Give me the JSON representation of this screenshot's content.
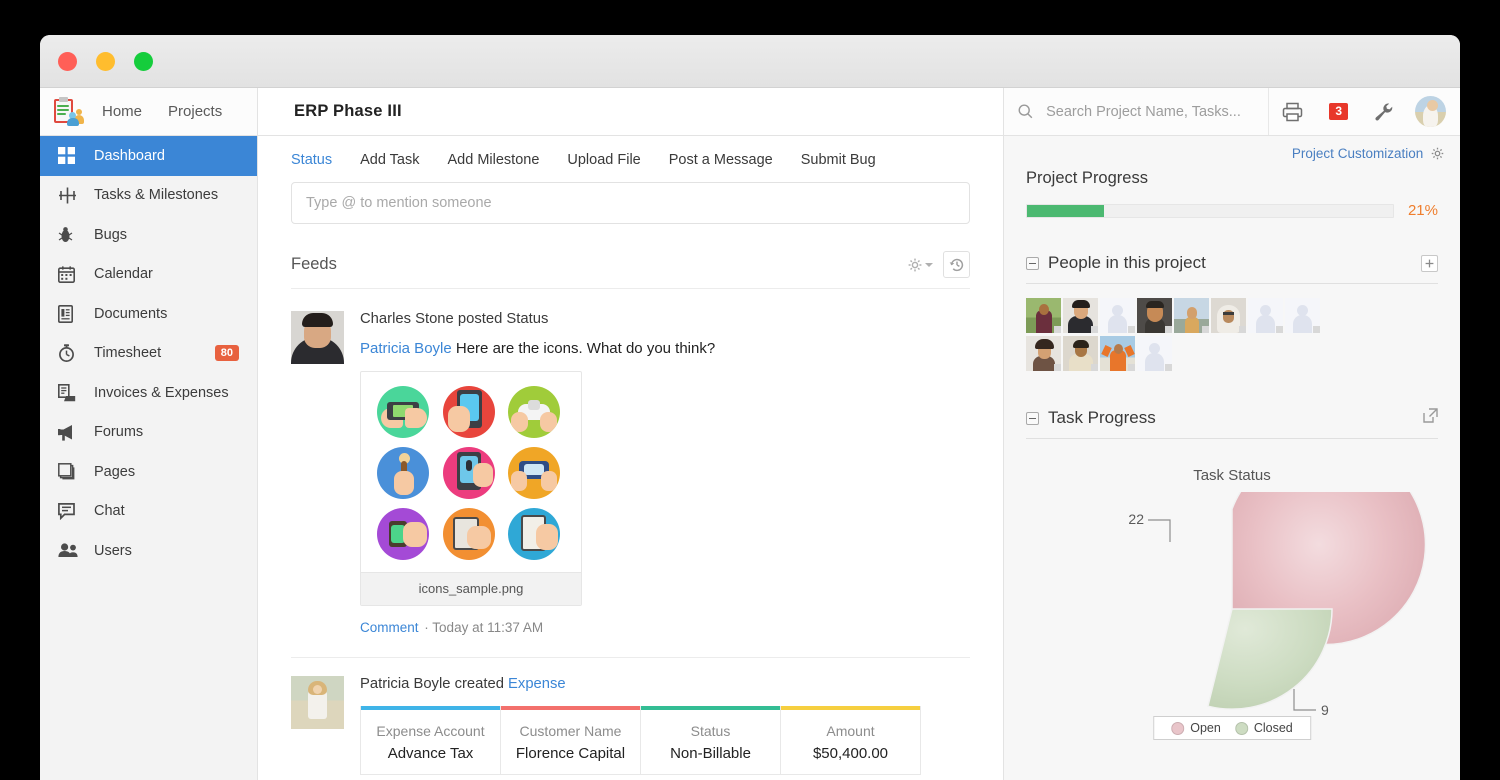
{
  "window": {
    "controls": [
      "close",
      "minimize",
      "maximize"
    ]
  },
  "topbar": {
    "logo_name": "zoho-projects-logo",
    "nav": [
      {
        "label": "Home",
        "name": "nav-home"
      },
      {
        "label": "Projects",
        "name": "nav-projects"
      }
    ],
    "project_title": "ERP Phase III",
    "search": {
      "placeholder": "Search Project Name, Tasks...",
      "value": ""
    },
    "print_icon": "printer-icon",
    "notification_count": "3",
    "settings_icon": "wrench-icon",
    "avatar": "user-avatar"
  },
  "sidebar": {
    "items": [
      {
        "label": "Dashboard",
        "icon": "grid-icon",
        "active": true,
        "badge": ""
      },
      {
        "label": "Tasks & Milestones",
        "icon": "milestone-icon",
        "active": false,
        "badge": ""
      },
      {
        "label": "Bugs",
        "icon": "bug-icon",
        "active": false,
        "badge": ""
      },
      {
        "label": "Calendar",
        "icon": "calendar-icon",
        "active": false,
        "badge": ""
      },
      {
        "label": "Documents",
        "icon": "document-icon",
        "active": false,
        "badge": ""
      },
      {
        "label": "Timesheet",
        "icon": "stopwatch-icon",
        "active": false,
        "badge": "80"
      },
      {
        "label": "Invoices & Expenses",
        "icon": "invoice-icon",
        "active": false,
        "badge": ""
      },
      {
        "label": "Forums",
        "icon": "megaphone-icon",
        "active": false,
        "badge": ""
      },
      {
        "label": "Pages",
        "icon": "pages-icon",
        "active": false,
        "badge": ""
      },
      {
        "label": "Chat",
        "icon": "chat-icon",
        "active": false,
        "badge": ""
      },
      {
        "label": "Users",
        "icon": "users-icon",
        "active": false,
        "badge": ""
      }
    ]
  },
  "main": {
    "tabs": [
      {
        "label": "Status",
        "active": true
      },
      {
        "label": "Add Task",
        "active": false
      },
      {
        "label": "Add Milestone",
        "active": false
      },
      {
        "label": "Upload File",
        "active": false
      },
      {
        "label": "Post a Message",
        "active": false
      },
      {
        "label": "Submit Bug",
        "active": false
      }
    ],
    "status_input": {
      "placeholder": "Type @ to mention someone",
      "value": ""
    },
    "feeds_title": "Feeds",
    "feeds_gear_icon": "gear-dropdown-icon",
    "feeds_history_icon": "history-icon",
    "feeds": [
      {
        "author_line": "Charles Stone posted Status",
        "mention": "Patricia Boyle",
        "text": " Here are the icons. What do you think?",
        "attachment": {
          "filename": "icons_sample.png"
        },
        "comment_label": "Comment",
        "separator": "·",
        "timestamp": "Today at 11:37 AM"
      },
      {
        "author_line_prefix": "Patricia Boyle created ",
        "author_line_link": "Expense",
        "expense": {
          "columns": [
            {
              "label": "Expense Account",
              "value": "Advance Tax",
              "color": "#3fb4e8"
            },
            {
              "label": "Customer Name",
              "value": "Florence Capital",
              "color": "#f3706c"
            },
            {
              "label": "Status",
              "value": "Non-Billable",
              "color": "#33bd94"
            },
            {
              "label": "Amount",
              "value": "$50,400.00",
              "color": "#f6cf3f"
            }
          ]
        }
      }
    ]
  },
  "right_panel": {
    "project_customization": "Project Customization",
    "project_customization_icon": "gear-icon",
    "progress": {
      "title": "Project Progress",
      "percent_label": "21%",
      "percent": 21,
      "fill_color": "#4cb971"
    },
    "people": {
      "title": "People in this project",
      "add_icon": "add-person-icon",
      "count": 12
    },
    "task_progress": {
      "title": "Task Progress",
      "expand_icon": "popout-icon"
    },
    "chart_data": {
      "type": "pie",
      "title": "Task Status",
      "categories": [
        "Open",
        "Closed"
      ],
      "values": [
        22,
        9
      ],
      "labels": [
        "22",
        "9"
      ],
      "colors": [
        "#e5b6bb",
        "#c6d6bb"
      ],
      "legend": "bottom",
      "grid": false
    }
  }
}
